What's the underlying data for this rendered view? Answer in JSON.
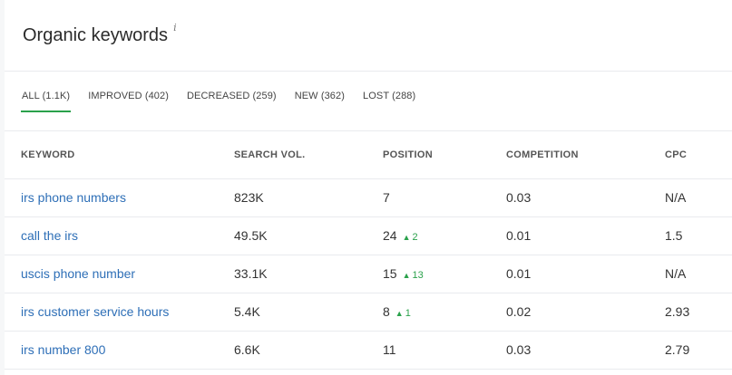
{
  "header": {
    "title": "Organic keywords",
    "info_icon": "i"
  },
  "tabs": [
    {
      "label": "ALL (1.1K)",
      "active": true
    },
    {
      "label": "IMPROVED (402)",
      "active": false
    },
    {
      "label": "DECREASED (259)",
      "active": false
    },
    {
      "label": "NEW (362)",
      "active": false
    },
    {
      "label": "LOST (288)",
      "active": false
    }
  ],
  "table": {
    "columns": [
      "KEYWORD",
      "SEARCH VOL.",
      "POSITION",
      "COMPETITION",
      "CPC"
    ],
    "rows": [
      {
        "keyword": "irs phone numbers",
        "search_vol": "823K",
        "position": "7",
        "delta": "",
        "competition": "0.03",
        "cpc": "N/A"
      },
      {
        "keyword": "call the irs",
        "search_vol": "49.5K",
        "position": "24",
        "delta": "2",
        "competition": "0.01",
        "cpc": "1.5"
      },
      {
        "keyword": "uscis phone number",
        "search_vol": "33.1K",
        "position": "15",
        "delta": "13",
        "competition": "0.01",
        "cpc": "N/A"
      },
      {
        "keyword": "irs customer service hours",
        "search_vol": "5.4K",
        "position": "8",
        "delta": "1",
        "competition": "0.02",
        "cpc": "2.93"
      },
      {
        "keyword": "irs number 800",
        "search_vol": "6.6K",
        "position": "11",
        "delta": "",
        "competition": "0.03",
        "cpc": "2.79"
      }
    ]
  },
  "colors": {
    "link": "#2e6fb7",
    "accent": "#2aa14b"
  },
  "icons": {
    "delta_up": "triangle-up-icon"
  }
}
